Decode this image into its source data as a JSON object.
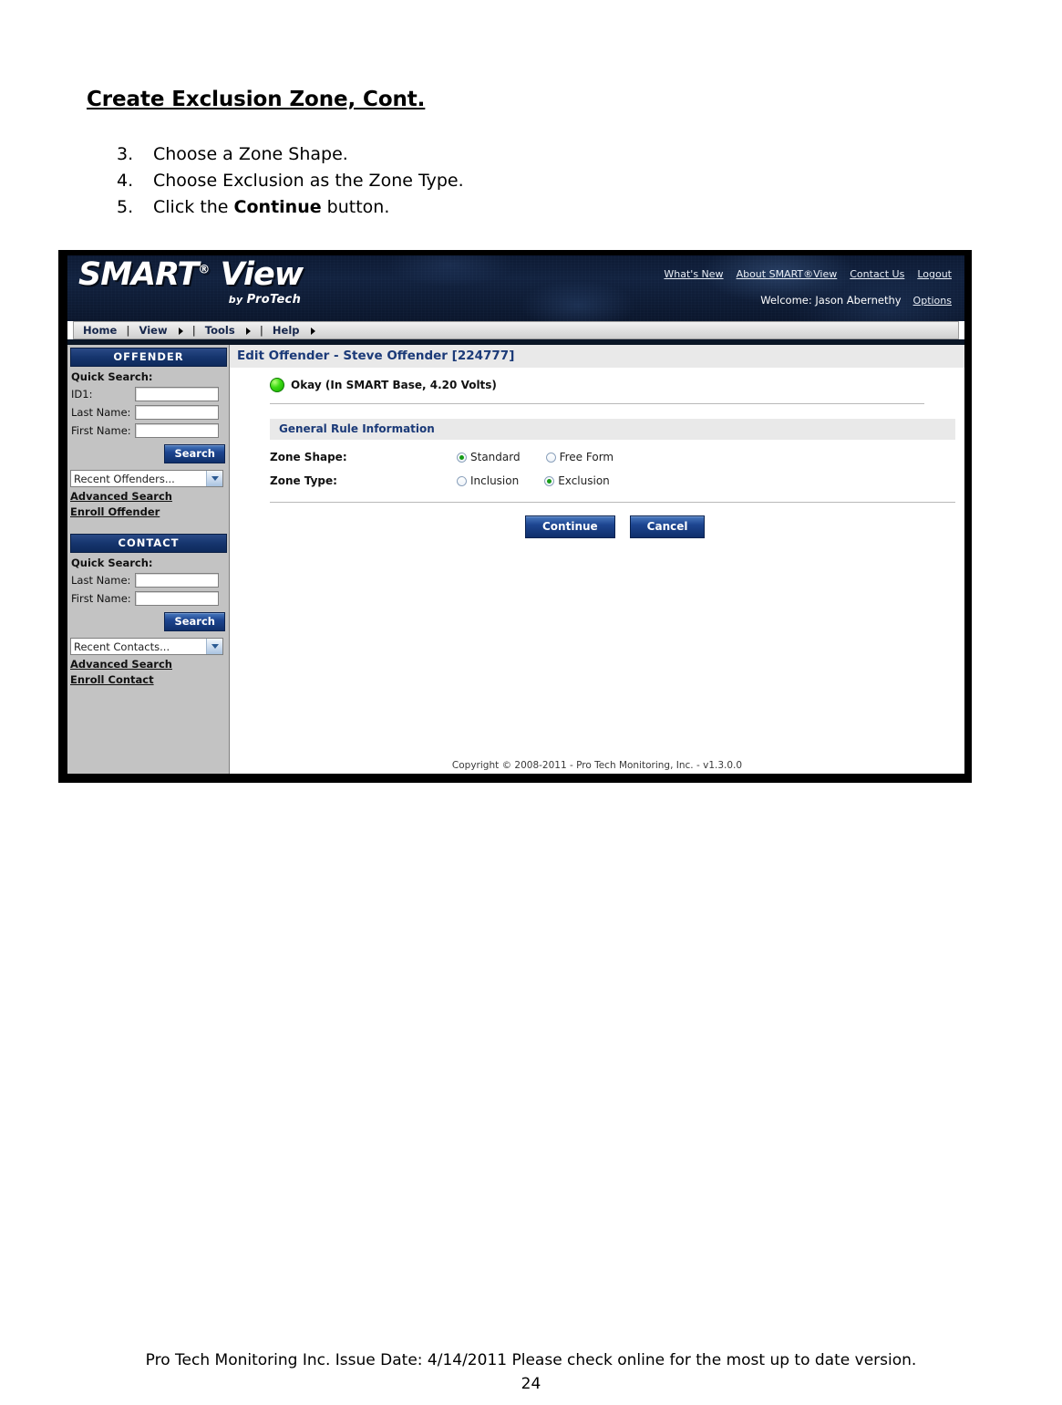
{
  "document": {
    "title": "Create Exclusion Zone, Cont.",
    "steps": [
      {
        "num": "3.",
        "pre": "Choose a Zone Shape.",
        "bold": "",
        "post": ""
      },
      {
        "num": "4.",
        "pre": "Choose Exclusion as the Zone Type.",
        "bold": "",
        "post": ""
      },
      {
        "num": "5.",
        "pre": "Click the ",
        "bold": "Continue",
        "post": " button."
      }
    ],
    "footer_line1": "Pro Tech Monitoring Inc. Issue Date: 4/14/2011 Please check online for the most up to date version.",
    "footer_page": "24"
  },
  "app": {
    "logo": {
      "smart": "SMART",
      "reg": "®",
      "view": "View",
      "by": "by ",
      "protech": "ProTech"
    },
    "header_links": [
      {
        "label": "What's New",
        "name": "whats-new-link"
      },
      {
        "label": "About SMART®View",
        "name": "about-smartview-link"
      },
      {
        "label": "Contact Us",
        "name": "contact-us-link"
      },
      {
        "label": "Logout",
        "name": "logout-link"
      }
    ],
    "welcome": "Welcome: Jason Abernethy",
    "options_label": "Options",
    "nav": [
      {
        "label": "Home",
        "arrow": false
      },
      {
        "label": "View",
        "arrow": true
      },
      {
        "label": "Tools",
        "arrow": true
      },
      {
        "label": "Help",
        "arrow": true
      }
    ],
    "nav_separator": "|",
    "sidebar": {
      "offender": {
        "header": "OFFENDER",
        "quick_search_label": "Quick Search:",
        "fields": [
          {
            "label": "ID1:",
            "value": "",
            "name": "offender-id1-input"
          },
          {
            "label": "Last Name:",
            "value": "",
            "name": "offender-last-name-input"
          },
          {
            "label": "First Name:",
            "value": "",
            "name": "offender-first-name-input"
          }
        ],
        "search_button": "Search",
        "recent_select": "Recent Offenders...",
        "links": [
          {
            "label": "Advanced Search",
            "name": "offender-advanced-search-link"
          },
          {
            "label": "Enroll Offender",
            "name": "enroll-offender-link"
          }
        ]
      },
      "contact": {
        "header": "CONTACT",
        "quick_search_label": "Quick Search:",
        "fields": [
          {
            "label": "Last Name:",
            "value": "",
            "name": "contact-last-name-input"
          },
          {
            "label": "First Name:",
            "value": "",
            "name": "contact-first-name-input"
          }
        ],
        "search_button": "Search",
        "recent_select": "Recent Contacts...",
        "links": [
          {
            "label": "Advanced Search",
            "name": "contact-advanced-search-link"
          },
          {
            "label": "Enroll Contact",
            "name": "enroll-contact-link"
          }
        ]
      }
    },
    "content": {
      "page_title": "Edit Offender - Steve Offender [224777]",
      "status_text": "Okay (In SMART Base, 4.20 Volts)",
      "status_color": "#31cc10",
      "panel_header": "General Rule Information",
      "zone_shape": {
        "label": "Zone Shape:",
        "options": [
          {
            "label": "Standard",
            "selected": true,
            "name": "zone-shape-standard-radio"
          },
          {
            "label": "Free Form",
            "selected": false,
            "name": "zone-shape-free-form-radio"
          }
        ]
      },
      "zone_type": {
        "label": "Zone Type:",
        "options": [
          {
            "label": "Inclusion",
            "selected": false,
            "name": "zone-type-inclusion-radio"
          },
          {
            "label": "Exclusion",
            "selected": true,
            "name": "zone-type-exclusion-radio"
          }
        ]
      },
      "continue_button": "Continue",
      "cancel_button": "Cancel",
      "copyright": "Copyright © 2008-2011 - Pro Tech Monitoring, Inc. - v1.3.0.0"
    }
  }
}
